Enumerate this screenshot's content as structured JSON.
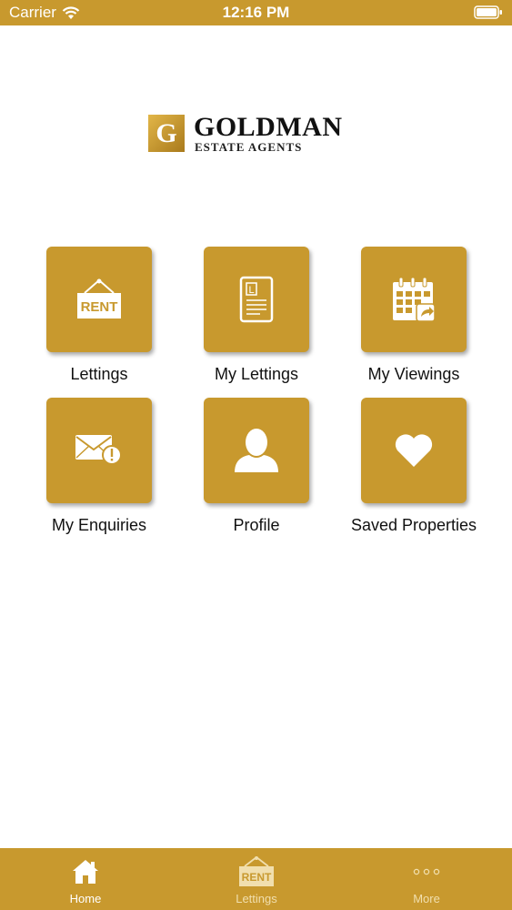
{
  "status_bar": {
    "carrier": "Carrier",
    "time": "12:16 PM"
  },
  "logo": {
    "badge_letter": "G",
    "name": "GOLDMAN",
    "subtitle": "ESTATE AGENTS"
  },
  "tiles": [
    {
      "label": "Lettings",
      "icon": "rent-sign-icon",
      "icon_text": "RENT"
    },
    {
      "label": "My Lettings",
      "icon": "document-icon",
      "icon_text": "L"
    },
    {
      "label": "My Viewings",
      "icon": "calendar-icon"
    },
    {
      "label": "My Enquiries",
      "icon": "envelope-alert-icon"
    },
    {
      "label": "Profile",
      "icon": "user-icon"
    },
    {
      "label": "Saved Properties",
      "icon": "heart-icon"
    }
  ],
  "tab_bar": {
    "tabs": [
      {
        "label": "Home",
        "icon": "home-icon",
        "active": true
      },
      {
        "label": "Lettings",
        "icon": "rent-sign-icon",
        "icon_text": "RENT",
        "active": false
      },
      {
        "label": "More",
        "icon": "more-icon",
        "active": false
      }
    ]
  },
  "colors": {
    "gold": "#c8992e",
    "background": "#ffffff",
    "text": "#111111"
  }
}
